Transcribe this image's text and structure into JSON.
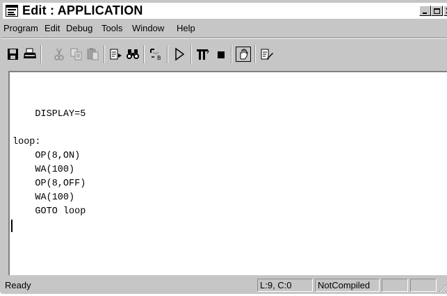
{
  "window": {
    "title": "Edit : APPLICATION"
  },
  "menubar": {
    "items": [
      "Program",
      "Edit",
      "Debug",
      "Tools",
      "Window",
      "Help"
    ]
  },
  "toolbar": {
    "icons": [
      "save-icon",
      "print-icon",
      "cut-icon",
      "copy-icon",
      "paste-icon",
      "find-replace-icon",
      "find-icon",
      "compile-icon",
      "run-icon",
      "pause-icon",
      "stop-icon",
      "hand-icon",
      "edit-document-icon"
    ]
  },
  "editor": {
    "lines": [
      "",
      "    DISPLAY=5",
      "",
      "loop:",
      "    OP(8,ON)",
      "    WA(100)",
      "    OP(8,OFF)",
      "    WA(100)",
      "    GOTO loop"
    ]
  },
  "statusbar": {
    "status": "Ready",
    "position": "L:9, C:0",
    "compile_state": "NotCompiled",
    "extra1": "",
    "extra2": ""
  }
}
